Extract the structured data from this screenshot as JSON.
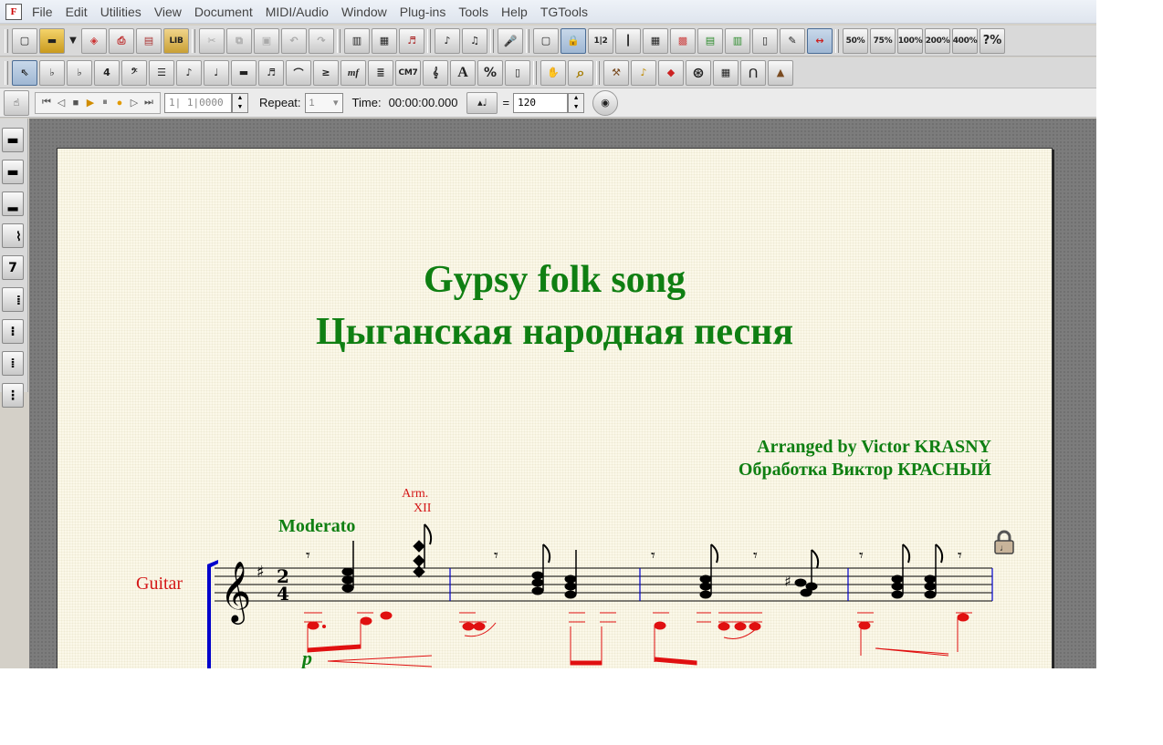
{
  "app": {
    "icon_letter": "F"
  },
  "menu": [
    "File",
    "Edit",
    "Utilities",
    "View",
    "Document",
    "MIDI/Audio",
    "Window",
    "Plug-ins",
    "Tools",
    "Help",
    "TGTools"
  ],
  "toolbar1": {
    "file_buttons": [
      {
        "name": "new-document-icon",
        "glyph": "▢"
      },
      {
        "name": "open-folder-icon",
        "glyph": "▬"
      },
      {
        "name": "save-disk-icon",
        "glyph": "◈"
      },
      {
        "name": "print-icon",
        "glyph": "⎙"
      },
      {
        "name": "book-icon",
        "glyph": "▤"
      },
      {
        "name": "library-icon",
        "glyph": "LIB"
      }
    ],
    "edit_buttons": [
      {
        "name": "cut-icon",
        "glyph": "✂"
      },
      {
        "name": "copy-icon",
        "glyph": "⧉"
      },
      {
        "name": "paste-icon",
        "glyph": "▣"
      },
      {
        "name": "undo-icon",
        "glyph": "↶"
      },
      {
        "name": "redo-icon",
        "glyph": "↷"
      }
    ],
    "view_buttons": [
      {
        "name": "scroll-view-icon",
        "glyph": "▥"
      },
      {
        "name": "page-view-icon",
        "glyph": "▦"
      },
      {
        "name": "studio-view-icon",
        "glyph": "♬"
      },
      {
        "name": "speedy-entry-icon",
        "glyph": "♪"
      },
      {
        "name": "simple-entry-icon",
        "glyph": "♫"
      },
      {
        "name": "microphone-icon",
        "glyph": "🎤"
      },
      {
        "name": "staff-tool-icon",
        "glyph": "▢"
      },
      {
        "name": "padlock-tool-icon",
        "glyph": "🔒"
      },
      {
        "name": "measure-numbers-icon",
        "glyph": "1|2"
      },
      {
        "name": "measure-tool-icon",
        "glyph": "┃"
      },
      {
        "name": "graphics-tool-icon",
        "glyph": "▦"
      },
      {
        "name": "grid-tool-icon",
        "glyph": "▩"
      },
      {
        "name": "staff-style-icon",
        "glyph": "▤"
      },
      {
        "name": "layout-tool-icon",
        "glyph": "▥"
      },
      {
        "name": "page-layout-icon",
        "glyph": "▯"
      },
      {
        "name": "text-page-icon",
        "glyph": "✎"
      },
      {
        "name": "resize-tool-icon",
        "glyph": "↔"
      }
    ],
    "zoom_buttons": [
      "50%",
      "75%",
      "100%",
      "200%",
      "400%",
      "?%"
    ]
  },
  "toolbar2": {
    "buttons": [
      {
        "name": "selection-tool-icon",
        "glyph": "⇖"
      },
      {
        "name": "key-signature-icon",
        "glyph": "♭"
      },
      {
        "name": "flat-clef-icon",
        "glyph": "♭"
      },
      {
        "name": "time-signature-icon",
        "glyph": "4"
      },
      {
        "name": "bass-clef-icon",
        "glyph": "𝄢"
      },
      {
        "name": "measure-icon",
        "glyph": "☰"
      },
      {
        "name": "note-icon",
        "glyph": "♪"
      },
      {
        "name": "beam-note-icon",
        "glyph": "♩"
      },
      {
        "name": "piano-icon",
        "glyph": "▬"
      },
      {
        "name": "tuplet-icon",
        "glyph": "♬"
      },
      {
        "name": "slur-icon",
        "glyph": "⌒"
      },
      {
        "name": "articulation-icon",
        "glyph": "≥"
      },
      {
        "name": "expression-icon",
        "glyph": "mf"
      },
      {
        "name": "staff-lines-icon",
        "glyph": "≣"
      },
      {
        "name": "chord-symbol-icon",
        "glyph": "CM7"
      },
      {
        "name": "lyrics-icon",
        "glyph": "𝄞"
      },
      {
        "name": "text-tool-icon",
        "glyph": "A"
      },
      {
        "name": "percent-icon",
        "glyph": "%"
      },
      {
        "name": "page-tool-icon",
        "glyph": "▯"
      },
      {
        "name": "hand-grabber-icon",
        "glyph": "✋"
      },
      {
        "name": "zoom-magnifier-icon",
        "glyph": "⌕"
      },
      {
        "name": "hammer-tool-icon",
        "glyph": "⚒"
      },
      {
        "name": "plugin-tool-icon",
        "glyph": "♪"
      },
      {
        "name": "color-tool-icon",
        "glyph": "◆"
      },
      {
        "name": "film-reel-icon",
        "glyph": "⊛"
      },
      {
        "name": "midi-tool-icon",
        "glyph": "▦"
      },
      {
        "name": "arch-tool-icon",
        "glyph": "⋂"
      },
      {
        "name": "metronome-icon",
        "glyph": "▲"
      }
    ]
  },
  "playback": {
    "counter_value": "1| 1|0000",
    "repeat_label": "Repeat:",
    "repeat_value": "1",
    "time_label": "Time:",
    "time_value": "00:00:00.000",
    "equals": "=",
    "tempo_value": "120"
  },
  "palette": [
    "𝄻",
    "𝄼",
    "𝄼",
    "𝄽",
    "𝄾",
    "𝄿",
    "𝅀",
    "𝅁",
    "𝅂"
  ],
  "score": {
    "title_en": "Gypsy folk song",
    "title_ru": "Цыганская народная песня",
    "arranger_en": "Arranged by Victor KRASNY",
    "arranger_ru": "Обработка Виктор КРАСНЫЙ",
    "tempo_marking": "Moderato",
    "harmonic_line1": "Arm.",
    "harmonic_line2": "XII",
    "instrument": "Guitar",
    "time_signature_top": "2",
    "time_signature_bottom": "4",
    "dynamic": "p",
    "measures": 4
  },
  "colors": {
    "title_green": "#0f7f12",
    "red_text": "#d41818",
    "bracket_blue": "#0000cc",
    "page_bg": "#fbf8e9"
  }
}
